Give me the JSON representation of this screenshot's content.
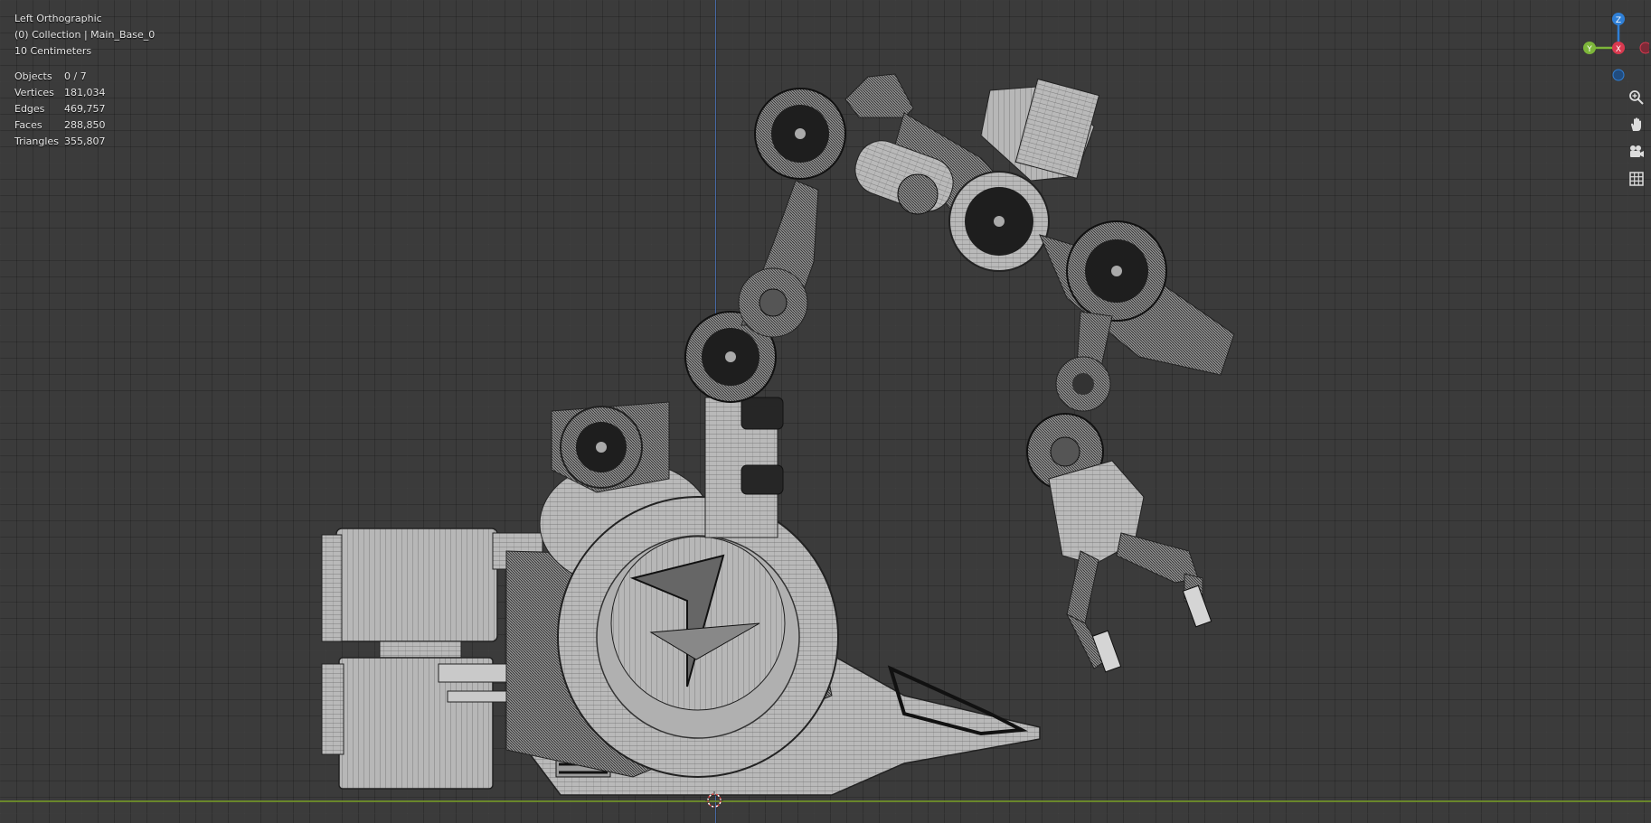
{
  "viewport": {
    "view_name": "Left Orthographic",
    "collection_path": "(0) Collection | Main_Base_0",
    "grid_scale": "10 Centimeters"
  },
  "stats": [
    {
      "label": "Objects",
      "value": "0 / 7"
    },
    {
      "label": "Vertices",
      "value": "181,034"
    },
    {
      "label": "Edges",
      "value": "469,757"
    },
    {
      "label": "Faces",
      "value": "288,850"
    },
    {
      "label": "Triangles",
      "value": "355,807"
    }
  ],
  "gizmo": {
    "z_label": "Z",
    "y_label": "Y",
    "x_label": "X",
    "colors": {
      "z": "#2f7fd6",
      "y": "#7db63a",
      "x": "#d8394f"
    }
  },
  "tools": [
    {
      "icon": "zoom-icon",
      "glyph": "⊕"
    },
    {
      "icon": "pan-hand-icon",
      "glyph": "✋"
    },
    {
      "icon": "camera-icon",
      "glyph": "🎥"
    },
    {
      "icon": "perspective-grid-icon",
      "glyph": "▦"
    }
  ],
  "colors": {
    "background": "#3b3b3b",
    "axis_y_line": "#4a72b8",
    "axis_x_line": "#6f8f2a",
    "model_fill": "#b9b9b9",
    "wire": "#1a1a1a"
  }
}
